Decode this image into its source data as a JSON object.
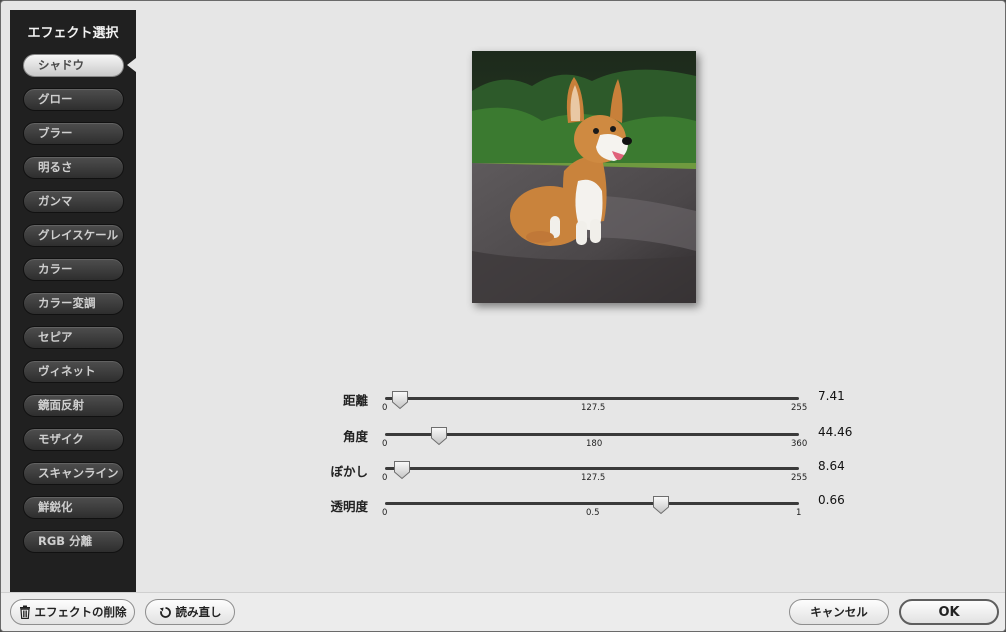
{
  "sidebar": {
    "title": "エフェクト選択",
    "items": [
      {
        "label": "シャドウ",
        "selected": true
      },
      {
        "label": "グロー"
      },
      {
        "label": "ブラー"
      },
      {
        "label": "明るさ"
      },
      {
        "label": "ガンマ"
      },
      {
        "label": "グレイスケール"
      },
      {
        "label": "カラー"
      },
      {
        "label": "カラー変調"
      },
      {
        "label": "セピア"
      },
      {
        "label": "ヴィネット"
      },
      {
        "label": "鏡面反射"
      },
      {
        "label": "モザイク"
      },
      {
        "label": "スキャンライン"
      },
      {
        "label": "鮮鋭化"
      },
      {
        "label": "RGB 分離"
      }
    ]
  },
  "sliders": [
    {
      "label": "距離",
      "min": "0",
      "mid": "127.5",
      "max": "255",
      "value": "7.41",
      "fraction": 0.029
    },
    {
      "label": "角度",
      "min": "0",
      "mid": "180",
      "max": "360",
      "value": "44.46",
      "fraction": 0.1235
    },
    {
      "label": "ぼかし",
      "min": "0",
      "mid": "127.5",
      "max": "255",
      "value": "8.64",
      "fraction": 0.0339
    },
    {
      "label": "透明度",
      "min": "0",
      "mid": "0.5",
      "max": "1",
      "value": "0.66",
      "fraction": 0.66
    }
  ],
  "footer": {
    "delete_label": "エフェクトの削除",
    "reload_label": "読み直し",
    "cancel_label": "キャンセル",
    "ok_label": "OK"
  },
  "colors": {
    "sidebar_bg": "#202020",
    "panel_bg": "#e6e6e6"
  },
  "icons": {
    "delete": "trash-icon",
    "reload": "reload-icon"
  }
}
